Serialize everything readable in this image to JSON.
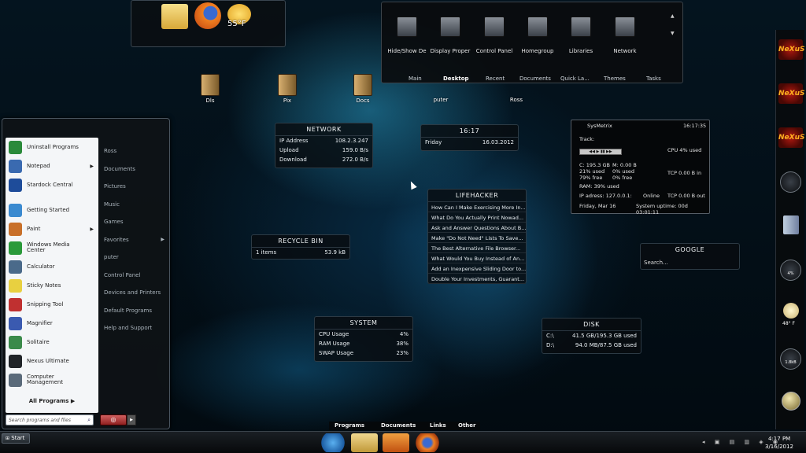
{
  "desktop_icons": [
    {
      "label": "Dls"
    },
    {
      "label": "Pix"
    },
    {
      "label": "Docs"
    },
    {
      "label": "puter"
    },
    {
      "label": "Ross"
    }
  ],
  "top_dock": {
    "weather": "55°F"
  },
  "tiles_dock": {
    "tiles": [
      "Hide/Show De",
      "Display Proper",
      "Control Panel",
      "Homegroup",
      "Libraries",
      "Network"
    ],
    "tabs": [
      "Main",
      "Desktop",
      "Recent",
      "Documents",
      "Quick La...",
      "Themes",
      "Tasks"
    ]
  },
  "network": {
    "title": "NETWORK",
    "rows": [
      [
        "IP Address",
        "108.2.3.247"
      ],
      [
        "Upload",
        "159.0 B/s"
      ],
      [
        "Download",
        "272.0 B/s"
      ]
    ]
  },
  "clock": {
    "time": "16:17",
    "day": "Friday",
    "date": "16.03.2012"
  },
  "lifehacker": {
    "title": "LIFEHACKER",
    "items": [
      "How Can I Make Exercising More In...",
      "What Do You Actually Print Nowad...",
      "Ask and Answer Questions About B...",
      "Make \"Do Not Need\" Lists To Save...",
      "The Best Alternative File Browser...",
      "What Would You Buy Instead of An...",
      "Add an Inexpensive Sliding Door to...",
      "Double Your Investments, Guarant..."
    ]
  },
  "recycle": {
    "title": "RECYCLE BIN",
    "items": "1 items",
    "size": "53.9 kB"
  },
  "sysmetrix": {
    "title": "SysMetrix",
    "time": "16:17:35",
    "track": "Track:",
    "cpu": "CPU 4% used",
    "disk": [
      "C: 195.3 GB",
      "21% used",
      "79% free"
    ],
    "mem": [
      "M: 0.00 B",
      "0% used",
      "0% free"
    ],
    "tcp_in": "TCP 0.00 B in",
    "ram": "RAM: 39% used",
    "ip": "IP adress: 127.0.0.1:",
    "online": "Online",
    "tcp_out": "TCP 0.00 B out",
    "date": "Friday, Mar 16",
    "uptime": "System uptime: 00d 03:01:11"
  },
  "google": {
    "title": "GOOGLE",
    "placeholder": "Search..."
  },
  "system": {
    "title": "SYSTEM",
    "rows": [
      [
        "CPU Usage",
        "4%"
      ],
      [
        "RAM Usage",
        "38%"
      ],
      [
        "SWAP Usage",
        "23%"
      ]
    ]
  },
  "disk": {
    "title": "DISK",
    "rows": [
      [
        "C:\\",
        "41.5 GB/195.3 GB used"
      ],
      [
        "D:\\",
        "94.0 MB/87.5 GB used"
      ]
    ]
  },
  "start_menu": {
    "left": [
      {
        "label": "Uninstall Programs",
        "color": "#2a8a3a"
      },
      {
        "label": "Notepad",
        "color": "#3a6ab0",
        "arrow": "▶"
      },
      {
        "label": "Stardock Central",
        "color": "#1e4c9a"
      },
      {
        "label": "Getting Started",
        "color": "#3a8ad0"
      },
      {
        "label": "Paint",
        "color": "#c8702a",
        "arrow": "▶"
      },
      {
        "label": "Windows Media Center",
        "color": "#2a9a3a"
      },
      {
        "label": "Calculator",
        "color": "#4a6a8a"
      },
      {
        "label": "Sticky Notes",
        "color": "#e8d040"
      },
      {
        "label": "Snipping Tool",
        "color": "#c03030"
      },
      {
        "label": "Magnifier",
        "color": "#3a5ab0"
      },
      {
        "label": "Solitaire",
        "color": "#3a8a4a"
      },
      {
        "label": "Nexus Ultimate",
        "color": "#202428"
      },
      {
        "label": "Computer Management",
        "color": "#5a6a7a"
      }
    ],
    "all_programs": "All Programs",
    "search_placeholder": "Search programs and files",
    "right": [
      {
        "label": "Ross"
      },
      {
        "label": "Documents"
      },
      {
        "label": "Pictures"
      },
      {
        "label": "Music"
      },
      {
        "label": "Games"
      },
      {
        "label": "Favorites",
        "arrow": "▶"
      },
      {
        "label": "puter"
      },
      {
        "label": "Control Panel"
      },
      {
        "label": "Devices and Printers"
      },
      {
        "label": "Default Programs"
      },
      {
        "label": "Help and Support"
      }
    ]
  },
  "launcher_tabs": [
    "Programs",
    "Documents",
    "Links",
    "Other"
  ],
  "taskbar": {
    "start": "Start",
    "time": "4:17 PM",
    "date": "3/16/2012"
  },
  "sidebar": {
    "nexus": "NeXuS",
    "cpu_gauge": "4%",
    "weather": "48° F",
    "net_gauge": "1.8kB"
  }
}
